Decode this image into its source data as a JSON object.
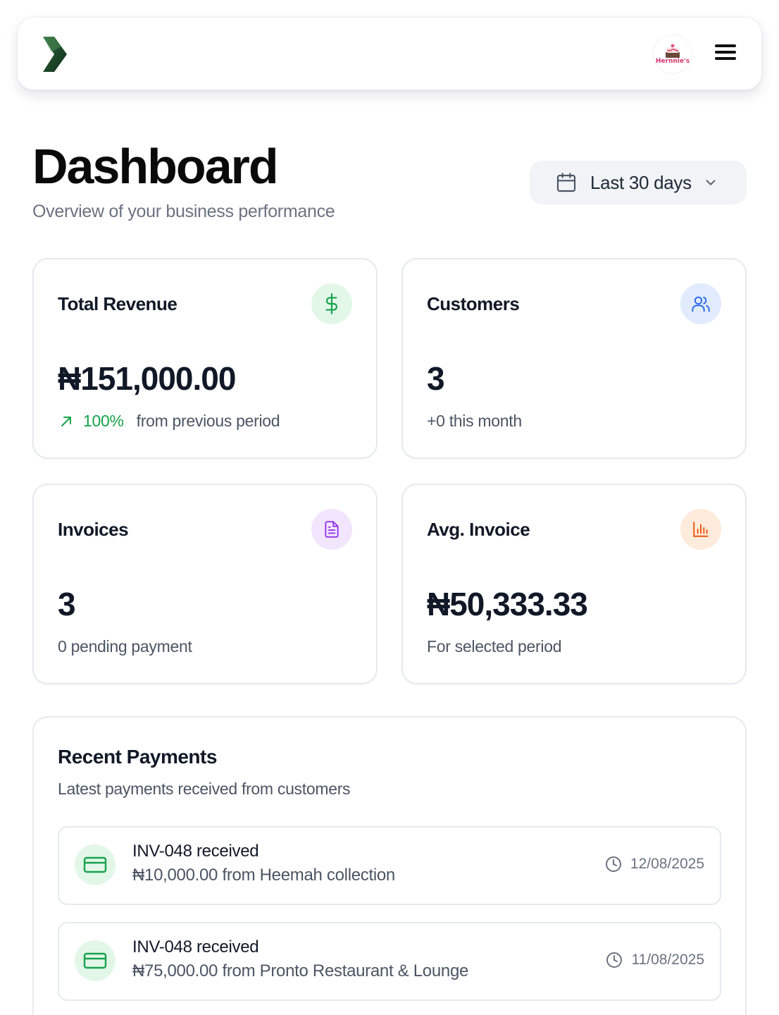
{
  "header": {
    "logo_icon": "brand-chevron-logo",
    "avatar_text": "Hernnie's",
    "menu_icon": "hamburger-menu-icon"
  },
  "page": {
    "title": "Dashboard",
    "subtitle": "Overview of your business performance"
  },
  "date_range": {
    "label": "Last 30 days",
    "icon": "calendar-icon"
  },
  "stats": {
    "revenue": {
      "title": "Total Revenue",
      "value": "₦151,000.00",
      "trend": "100%",
      "trend_text": "from previous period",
      "icon": "dollar-icon",
      "icon_bg": "#e3f7e9",
      "icon_color": "#16a34a"
    },
    "customers": {
      "title": "Customers",
      "value": "3",
      "sub": "+0 this month",
      "icon": "users-icon",
      "icon_bg": "#e1ebfd",
      "icon_color": "#2563eb"
    },
    "invoices": {
      "title": "Invoices",
      "value": "3",
      "sub": "0 pending payment",
      "icon": "document-icon",
      "icon_bg": "#f1e6fd",
      "icon_color": "#9333ea"
    },
    "avg_invoice": {
      "title": "Avg. Invoice",
      "value": "₦50,333.33",
      "sub": "For selected period",
      "icon": "bar-chart-icon",
      "icon_bg": "#fdebdc",
      "icon_color": "#ea580c"
    }
  },
  "recent_payments": {
    "title": "Recent Payments",
    "subtitle": "Latest payments received from customers",
    "items": [
      {
        "heading": "INV-048 received",
        "detail": "₦10,000.00 from Heemah collection",
        "date": "12/08/2025"
      },
      {
        "heading": "INV-048 received",
        "detail": "₦75,000.00 from Pronto Restaurant & Lounge",
        "date": "11/08/2025"
      }
    ]
  }
}
